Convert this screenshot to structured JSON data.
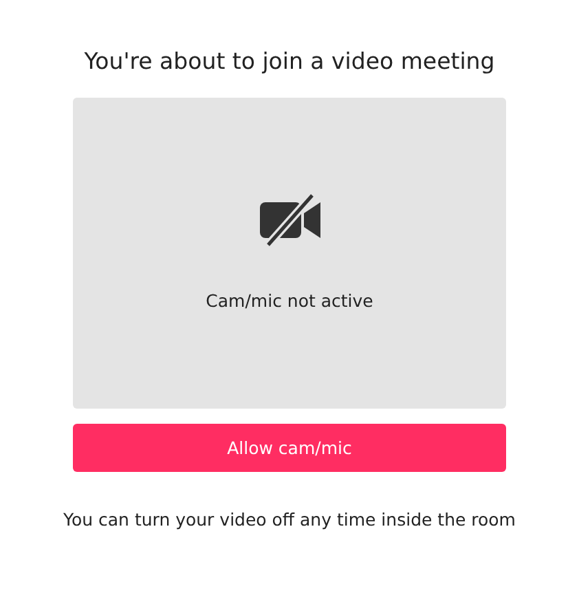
{
  "title": "You're about to join a video meeting",
  "preview": {
    "status": "Cam/mic not active"
  },
  "button": "Allow cam/mic",
  "note": "You can turn your video off any time inside the room"
}
